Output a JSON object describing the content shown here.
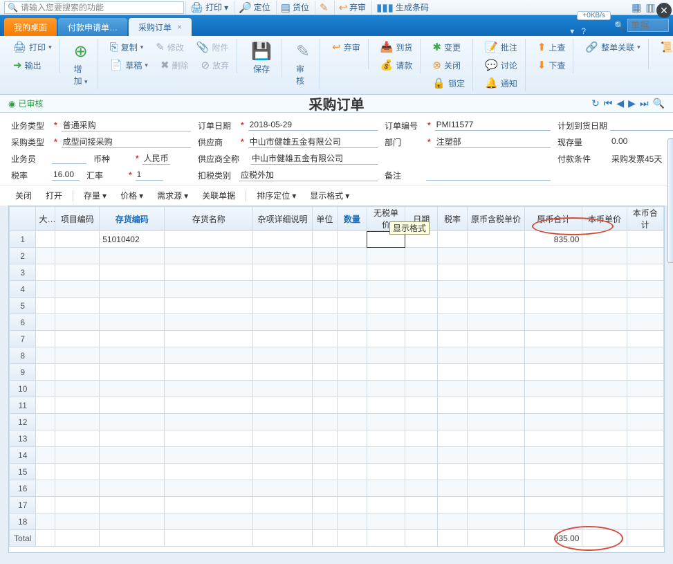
{
  "sys": {
    "search_placeholder": "请输入您要搜索的功能",
    "buttons": {
      "print": "打印",
      "locate": "定位",
      "inventory": "货位",
      "reject": "弃审",
      "barcode": "生成条码"
    },
    "speed": "+0KB/s"
  },
  "tabs": {
    "t1": "我的桌面",
    "t2": "付款申请单…",
    "t3": "采购订单"
  },
  "tabbar_search_placeholder": "单据…",
  "ribbon": {
    "print": "打印",
    "print_dd": "▾",
    "output": "输出",
    "add": "增加",
    "add_dd": "▾",
    "copy": "复制",
    "copy_dd": "▾",
    "modify": "修改",
    "attach": "附件",
    "draft": "草稿",
    "draft_dd": "▾",
    "delete": "删除",
    "discard": "放弃",
    "save": "保存",
    "audit": "审核",
    "reject": "弃审",
    "arrive": "到货",
    "request": "请款",
    "change": "变更",
    "close": "关闭",
    "lock": "锁定",
    "approve": "批注",
    "discuss": "讨论",
    "notify": "通知",
    "up": "上查",
    "down": "下查",
    "link": "整单关联",
    "link_dd": "▾",
    "log": "查看日志",
    "log_dd": "▾"
  },
  "doc": {
    "status": "已审核",
    "title": "采购订单"
  },
  "form": {
    "labels": {
      "biz_type": "业务类型",
      "order_date": "订单日期",
      "order_no": "订单编号",
      "plan_date": "计划到货日期",
      "po_type": "采购类型",
      "supplier": "供应商",
      "dept": "部门",
      "onhand": "现存量",
      "clerk": "业务员",
      "currency": "币种",
      "supplier_full": "供应商全称",
      "pay_term": "付款条件",
      "tax_rate": "税率",
      "rate": "汇率",
      "deduct": "扣税类别",
      "remark": "备注"
    },
    "values": {
      "biz_type": "普通采购",
      "order_date": "2018-05-29",
      "order_no": "PMI11577",
      "plan_date": "",
      "po_type": "成型间接采购",
      "supplier": "中山市健雄五金有限公司",
      "dept": "注塑部",
      "onhand": "0.00",
      "clerk": "",
      "currency": "人民币",
      "supplier_full": "中山市健雄五金有限公司",
      "pay_term": "采购发票45天",
      "tax_rate": "16.00",
      "rate": "1",
      "deduct": "应税外加",
      "remark": ""
    }
  },
  "grid_toolbar": {
    "close": "关闭",
    "open": "打开",
    "stock": "存量",
    "price": "价格",
    "demand": "需求源",
    "rel": "关联单据",
    "sort": "排序定位",
    "fmt": "显示格式"
  },
  "grid": {
    "headers": {
      "row": "",
      "cat": "大…",
      "proj": "项目编码",
      "inv": "存货编码",
      "name": "存货名称",
      "detail": "杂项详细说明",
      "unit": "单位",
      "qty": "数量",
      "price": "无税单价",
      "date": "日期",
      "tax": "税率",
      "gross": "原币含税单价",
      "yptotal": "原币合计",
      "bbprice": "本币单价",
      "bbtotal": "本币合计"
    },
    "tooltip": "显示格式",
    "rows": [
      {
        "inv": "51010402",
        "yptotal": "835.00"
      }
    ],
    "total_label": "Total",
    "total_yptotal": "835.00",
    "blank_count": 17
  }
}
